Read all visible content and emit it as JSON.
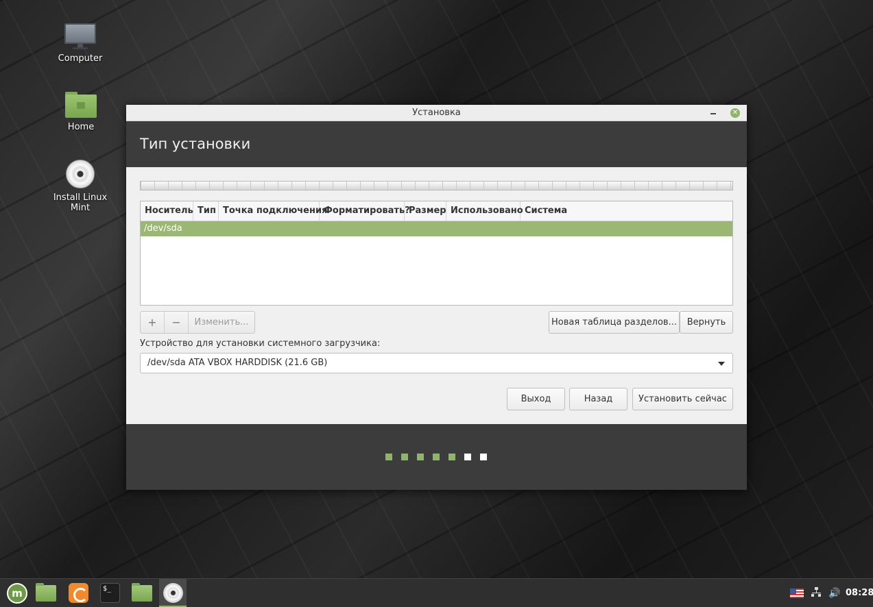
{
  "desktop": {
    "icons": [
      {
        "label": "Computer",
        "icon": "computer-icon"
      },
      {
        "label": "Home",
        "icon": "home-folder-icon"
      },
      {
        "label": "Install Linux Mint",
        "icon": "disc-icon"
      }
    ]
  },
  "window": {
    "title": "Установка",
    "header": "Тип установки",
    "table": {
      "columns": [
        "Носитель",
        "Тип",
        "Точка подключения",
        "Форматировать?",
        "Размер",
        "Использовано",
        "Система"
      ],
      "rows": [
        {
          "device": "/dev/sda"
        }
      ]
    },
    "toolbar": {
      "add_label": "+",
      "remove_label": "−",
      "change_label": "Изменить...",
      "new_table_label": "Новая таблица разделов...",
      "revert_label": "Вернуть"
    },
    "bootloader": {
      "label": "Устройство для установки системного загрузчика:",
      "selected": "/dev/sda ATA VBOX HARDDISK (21.6 GB)"
    },
    "buttons": {
      "quit": "Выход",
      "back": "Назад",
      "install": "Установить сейчас"
    },
    "progress": {
      "steps_total": 7,
      "steps_done": 5,
      "done_color": "#8fb46a",
      "pending_color": "#ffffff"
    }
  },
  "taskbar": {
    "items": [
      "mint-menu-icon",
      "show-desktop-icon",
      "firefox-icon",
      "terminal-icon",
      "files-icon",
      "installer-disc-icon"
    ],
    "tray": [
      "us-flag-icon",
      "network-icon",
      "volume-icon"
    ],
    "clock": "08:28"
  }
}
